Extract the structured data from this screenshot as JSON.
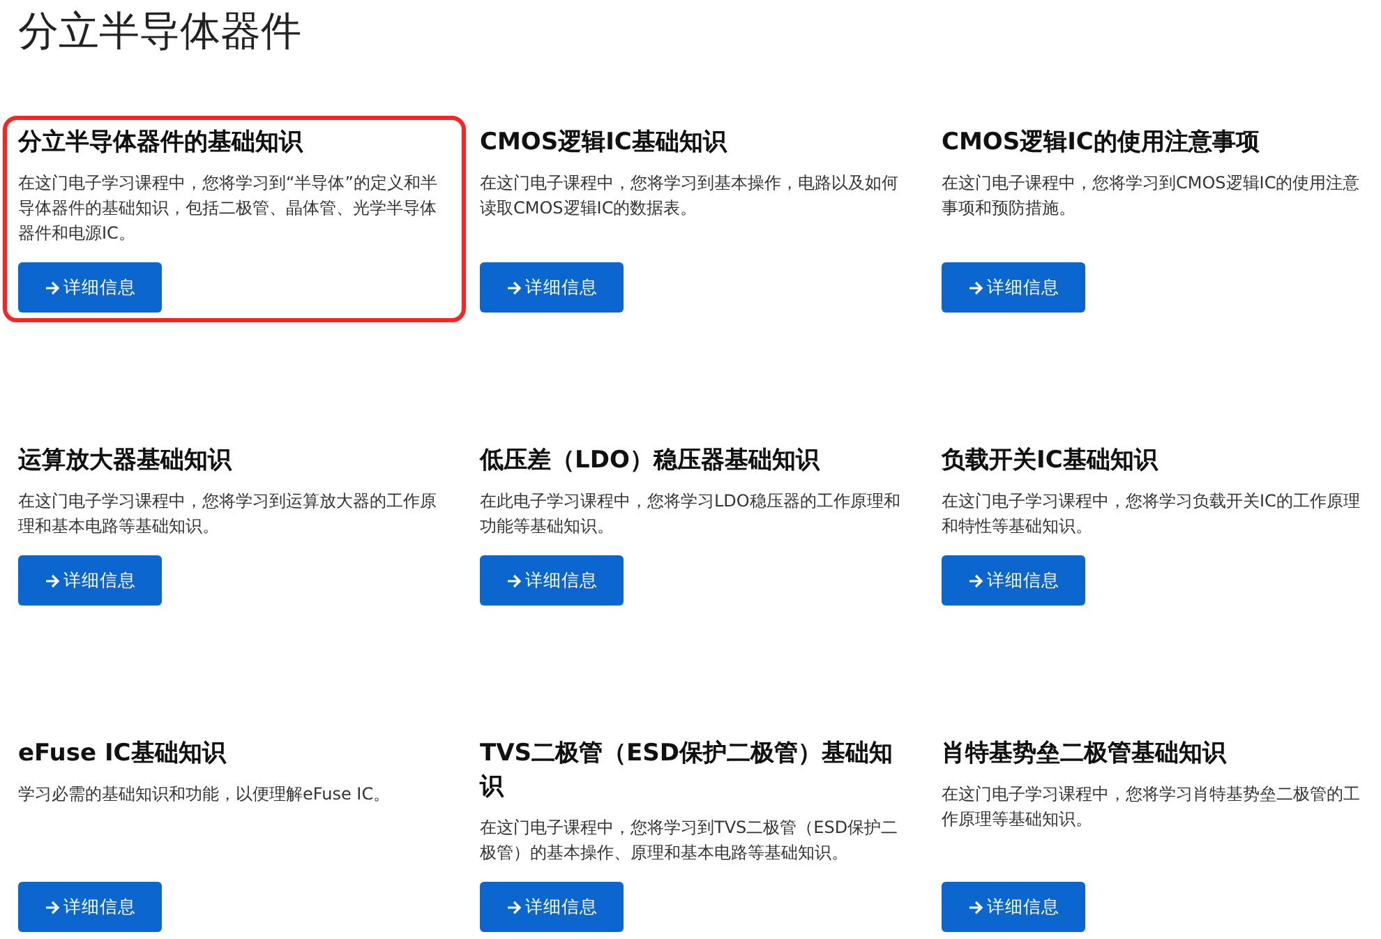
{
  "page_title": "分立半导体器件",
  "courses": [
    {
      "title": "分立半导体器件的基础知识",
      "description": "在这门电子学习课程中，您将学习到“半导体”的定义和半导体器件的基础知识，包括二极管、晶体管、光学半导体器件和电源IC。",
      "button": "详细信息",
      "highlighted": true
    },
    {
      "title": "CMOS逻辑IC基础知识",
      "description": "在这门电子课程中，您将学习到基本操作，电路以及如何读取CMOS逻辑IC的数据表。",
      "button": "详细信息",
      "highlighted": false
    },
    {
      "title": "CMOS逻辑IC的使用注意事项",
      "description": "在这门电子课程中，您将学习到CMOS逻辑IC的使用注意事项和预防措施。",
      "button": "详细信息",
      "highlighted": false
    },
    {
      "title": "运算放大器基础知识",
      "description": "在这门电子学习课程中，您将学习到运算放大器的工作原理和基本电路等基础知识。",
      "button": "详细信息",
      "highlighted": false
    },
    {
      "title": "低压差（LDO）稳压器基础知识",
      "description": "在此电子学习课程中，您将学习LDO稳压器的工作原理和功能等基础知识。",
      "button": "详细信息",
      "highlighted": false
    },
    {
      "title": "负载开关IC基础知识",
      "description": "在这门电子学习课程中，您将学习负载开关IC的工作原理和特性等基础知识。",
      "button": "详细信息",
      "highlighted": false
    },
    {
      "title": "eFuse IC基础知识",
      "description": "学习必需的基础知识和功能，以便理解eFuse IC。",
      "button": "详细信息",
      "highlighted": false
    },
    {
      "title": "TVS二极管（ESD保护二极管）基础知识",
      "description": "在这门电子课程中，您将学习到TVS二极管（ESD保护二极管）的基本操作、原理和基本电路等基础知识。",
      "button": "详细信息",
      "highlighted": false
    },
    {
      "title": "肖特基势垒二极管基础知识",
      "description": "在这门电子学习课程中，您将学习肖特基势垒二极管的工作原理等基础知识。",
      "button": "详细信息",
      "highlighted": false
    }
  ]
}
